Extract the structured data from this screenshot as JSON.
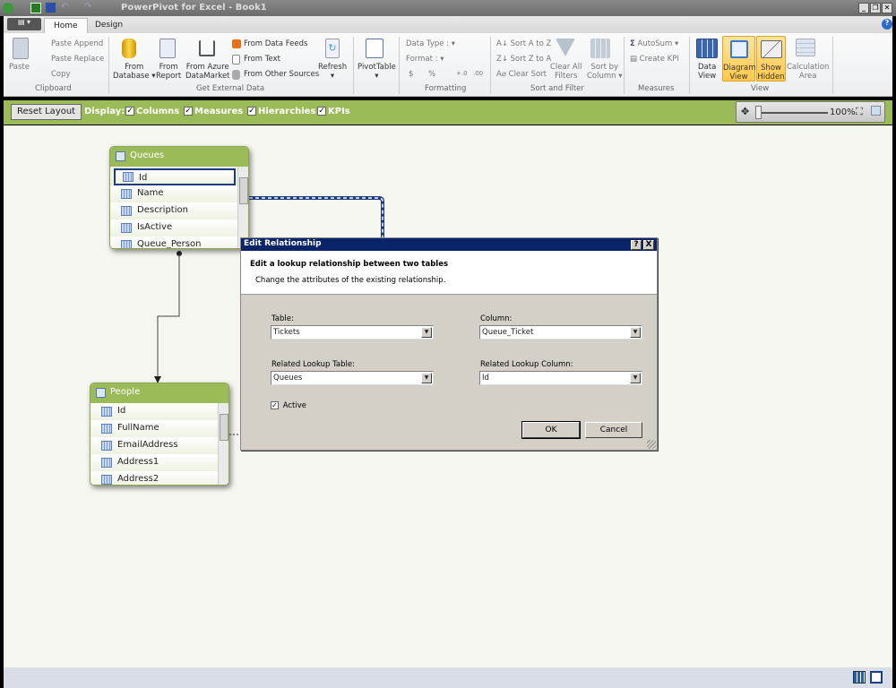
{
  "window": {
    "title": "PowerPivot for Excel - Book1"
  },
  "tabs": [
    {
      "label": "Home",
      "active": true
    },
    {
      "label": "Design"
    }
  ],
  "ribbon": {
    "clipboard": {
      "group": "Clipboard",
      "paste": "Paste",
      "paste_append": "Paste Append",
      "paste_replace": "Paste Replace",
      "copy": "Copy"
    },
    "external": {
      "group": "Get External Data",
      "from_database_1": "From",
      "from_database_2": "Database",
      "from_report_1": "From",
      "from_report_2": "Report",
      "from_azure_1": "From Azure",
      "from_azure_2": "DataMarket",
      "from_data_feeds": "From Data Feeds",
      "from_text": "From Text",
      "from_other": "From Other Sources",
      "refresh": "Refresh"
    },
    "pivot": {
      "label": "PivotTable"
    },
    "formatting": {
      "group": "Formatting",
      "data_type": "Data Type :",
      "format": "Format :",
      "currency": "$",
      "percent": "%"
    },
    "sort": {
      "group": "Sort and Filter",
      "sort_az": "Sort A to Z",
      "sort_za": "Sort Z to A",
      "clear_sort": "Clear Sort",
      "clear_filters_1": "Clear All",
      "clear_filters_2": "Filters",
      "sort_by_1": "Sort by",
      "sort_by_2": "Column"
    },
    "measures": {
      "group": "Measures",
      "autosum": "AutoSum",
      "create_kpi": "Create KPI"
    },
    "view": {
      "group": "View",
      "data_view_1": "Data",
      "data_view_2": "View",
      "diagram_1": "Diagram",
      "diagram_2": "View",
      "hidden_1": "Show",
      "hidden_2": "Hidden",
      "calc_1": "Calculation",
      "calc_2": "Area"
    }
  },
  "diagram_bar": {
    "reset_layout": "Reset Layout",
    "display_label": "Display:",
    "options": [
      {
        "label": "Columns",
        "checked": true
      },
      {
        "label": "Measures",
        "checked": true
      },
      {
        "label": "Hierarchies",
        "checked": true
      },
      {
        "label": "KPIs",
        "checked": true
      }
    ],
    "zoom": "100%"
  },
  "tables": [
    {
      "name": "Queues",
      "columns": [
        "Id",
        "Name",
        "Description",
        "IsActive",
        "Queue_Person"
      ],
      "selected": "Id"
    },
    {
      "name": "People",
      "columns": [
        "Id",
        "FullName",
        "EmailAddress",
        "Address1",
        "Address2"
      ]
    }
  ],
  "dialog": {
    "title": "Edit Relationship",
    "help": "?",
    "close": "X",
    "heading": "Edit a lookup relationship between two tables",
    "subheading": "Change the attributes of the existing relationship.",
    "table_label": "Table:",
    "table_value": "Tickets",
    "column_label": "Column:",
    "column_value": "Queue_Ticket",
    "lookup_table_label": "Related Lookup Table:",
    "lookup_table_value": "Queues",
    "lookup_column_label": "Related Lookup Column:",
    "lookup_column_value": "Id",
    "active_label": "Active",
    "active_checked": true,
    "ok": "OK",
    "cancel": "Cancel"
  },
  "colors": {
    "accent_green": "#9bbb59",
    "dialog_title": "#0a246a",
    "relationship_line": "#1f3a7a"
  }
}
